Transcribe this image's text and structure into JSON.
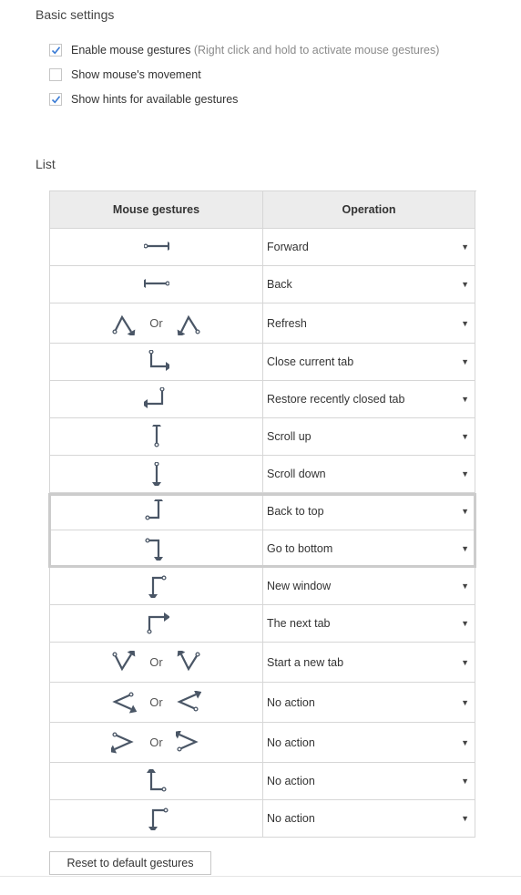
{
  "basic_settings": {
    "title": "Basic settings",
    "options": [
      {
        "label": "Enable mouse gestures",
        "hint": "(Right click and hold to activate mouse gestures)",
        "checked": true
      },
      {
        "label": "Show mouse's movement",
        "hint": "",
        "checked": false
      },
      {
        "label": "Show hints for available gestures",
        "hint": "",
        "checked": true
      }
    ]
  },
  "list": {
    "title": "List",
    "headers": {
      "gesture": "Mouse gestures",
      "operation": "Operation"
    },
    "or_label": "Or",
    "rows": [
      {
        "icon": "arrow-right-icon",
        "operation": "Forward"
      },
      {
        "icon": "arrow-left-icon",
        "operation": "Back"
      },
      {
        "icon": "up-down-zigzag-icon",
        "icon_alt": "up-down-zigzag-reverse-icon",
        "operation": "Refresh"
      },
      {
        "icon": "down-then-right-icon",
        "operation": "Close current tab"
      },
      {
        "icon": "up-then-left-icon",
        "operation": "Restore recently closed tab"
      },
      {
        "icon": "arrow-up-icon",
        "operation": "Scroll up"
      },
      {
        "icon": "arrow-down-icon",
        "operation": "Scroll down"
      },
      {
        "icon": "right-then-up-icon",
        "operation": "Back to top"
      },
      {
        "icon": "right-then-down-icon",
        "operation": "Go to bottom"
      },
      {
        "icon": "left-then-down-icon",
        "operation": "New window"
      },
      {
        "icon": "up-then-right-icon",
        "operation": "The next tab"
      },
      {
        "icon": "down-up-zigzag-icon",
        "icon_alt": "down-up-zigzag-reverse-icon",
        "operation": "Start a new tab"
      },
      {
        "icon": "left-right-chevron-left-icon",
        "icon_alt": "right-left-chevron-left-icon",
        "operation": "No action"
      },
      {
        "icon": "chevron-right-icon",
        "icon_alt": "chevron-right-reverse-icon",
        "operation": "No action"
      },
      {
        "icon": "up-then-right-reverse-icon",
        "operation": "No action"
      },
      {
        "icon": "right-then-down-left-icon",
        "operation": "No action"
      }
    ]
  },
  "reset_button": {
    "label": "Reset to default gestures"
  },
  "caret": "▼",
  "colors": {
    "icon": "#4a5666",
    "border": "#d6d6d6",
    "header_bg": "#ececec",
    "check": "#3a7bd5",
    "hint": "#8a8a8a"
  }
}
